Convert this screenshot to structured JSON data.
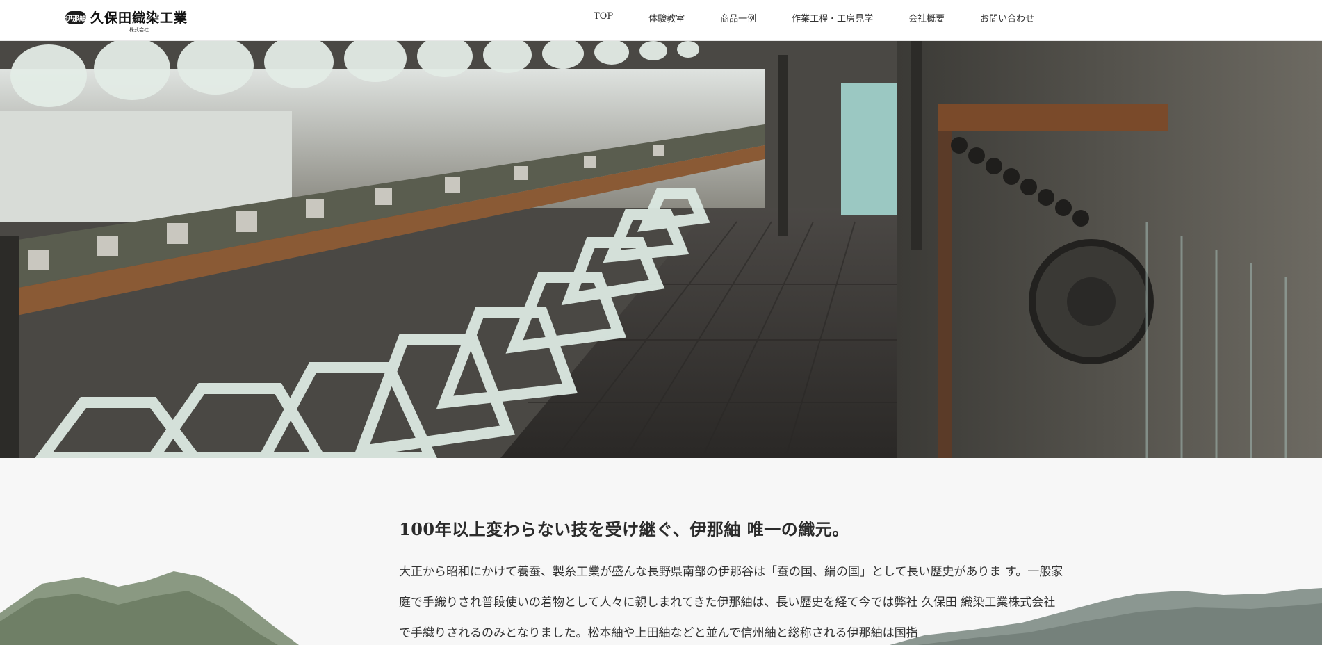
{
  "header": {
    "logo": {
      "mark": "伊那紬",
      "title": "久保田織染工業",
      "subtitle": "株式会社"
    },
    "nav": [
      {
        "label": "TOP",
        "active": true
      },
      {
        "label": "体験教室",
        "active": false
      },
      {
        "label": "商品一例",
        "active": false
      },
      {
        "label": "作業工程・工房見学",
        "active": false
      },
      {
        "label": "会社概要",
        "active": false
      },
      {
        "label": "お問い合わせ",
        "active": false
      }
    ]
  },
  "hero": {
    "image": "silk-reeling-factory-photo"
  },
  "main": {
    "headline": "100年以上変わらない技を受け継ぐ、伊那紬 唯一の織元。",
    "paragraph": "大正から昭和にかけて養蚕、製糸工業が盛んな長野県南部の伊那谷は「蚕の国、絹の国」として長い歴史がありま す。一般家庭で手織りされ普段使いの着物として人々に親しまれてきた伊那紬は、長い歴史を経て今では弊社 久保田 織染工業株式会社で手織りされるのみとなりました。松本紬や上田紬などと並んで信州紬と総称される伊那紬は国指"
  },
  "colors": {
    "background": "#f7f7f7",
    "header_bg": "#ffffff",
    "text": "#333333"
  }
}
